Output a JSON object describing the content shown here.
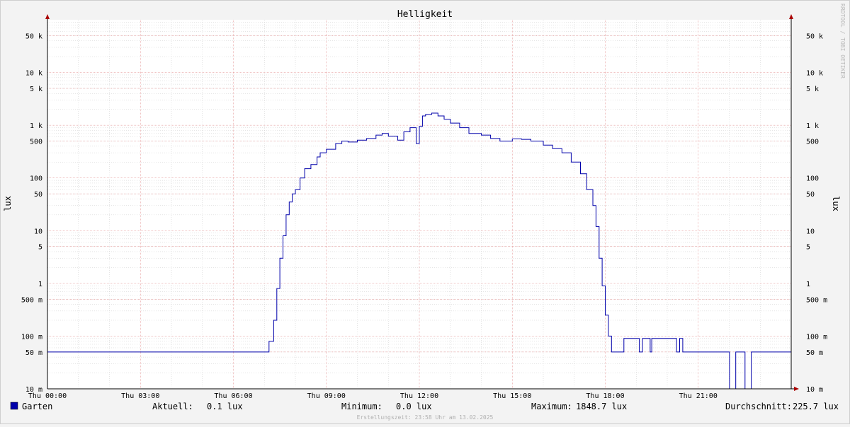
{
  "chart_data": {
    "type": "line",
    "title": "Helligkeit",
    "ylabel": "lux",
    "yscale": "log",
    "ylim": [
      0.01,
      100000
    ],
    "xlim": [
      0,
      24
    ],
    "grid": true,
    "watermark": "RRDTOOL / TOBI OETIKER",
    "y_ticks": [
      {
        "v": 50000,
        "label": "50 k"
      },
      {
        "v": 10000,
        "label": "10 k"
      },
      {
        "v": 5000,
        "label": "5 k"
      },
      {
        "v": 1000,
        "label": "1 k"
      },
      {
        "v": 500,
        "label": "500"
      },
      {
        "v": 100,
        "label": "100"
      },
      {
        "v": 50,
        "label": "50"
      },
      {
        "v": 10,
        "label": "10"
      },
      {
        "v": 5,
        "label": "5"
      },
      {
        "v": 1,
        "label": "1"
      },
      {
        "v": 0.5,
        "label": "500 m"
      },
      {
        "v": 0.1,
        "label": "100 m"
      },
      {
        "v": 0.05,
        "label": "50 m"
      },
      {
        "v": 0.01,
        "label": "10 m"
      }
    ],
    "x_ticks": [
      {
        "v": 0,
        "label": "Thu 00:00"
      },
      {
        "v": 3,
        "label": "Thu 03:00"
      },
      {
        "v": 6,
        "label": "Thu 06:00"
      },
      {
        "v": 9,
        "label": "Thu 09:00"
      },
      {
        "v": 12,
        "label": "Thu 12:00"
      },
      {
        "v": 15,
        "label": "Thu 15:00"
      },
      {
        "v": 18,
        "label": "Thu 18:00"
      },
      {
        "v": 21,
        "label": "Thu 21:00"
      }
    ],
    "series": [
      {
        "name": "Garten",
        "color": "#0000aa",
        "x": [
          0,
          7.1,
          7.15,
          7.3,
          7.4,
          7.5,
          7.6,
          7.7,
          7.8,
          7.9,
          8.0,
          8.15,
          8.3,
          8.5,
          8.7,
          8.8,
          9.0,
          9.3,
          9.5,
          9.7,
          10.0,
          10.3,
          10.6,
          10.8,
          11.0,
          11.3,
          11.5,
          11.7,
          11.9,
          12.0,
          12.1,
          12.2,
          12.4,
          12.6,
          12.8,
          13.0,
          13.3,
          13.6,
          14.0,
          14.3,
          14.6,
          15.0,
          15.3,
          15.6,
          16.0,
          16.3,
          16.6,
          16.9,
          17.2,
          17.4,
          17.6,
          17.7,
          17.8,
          17.9,
          18.0,
          18.1,
          18.2,
          18.4,
          18.6,
          19.0,
          19.1,
          19.2,
          19.4,
          19.45,
          19.5,
          20.2,
          20.3,
          20.4,
          20.5,
          22.0,
          22.01,
          22.2,
          22.21,
          22.5,
          22.51,
          22.7,
          22.71,
          24.0
        ],
        "values": [
          0.05,
          0.05,
          0.08,
          0.2,
          0.8,
          3,
          8,
          20,
          35,
          50,
          60,
          100,
          150,
          180,
          250,
          300,
          350,
          450,
          500,
          480,
          520,
          560,
          650,
          700,
          620,
          520,
          750,
          900,
          450,
          950,
          1500,
          1600,
          1700,
          1500,
          1300,
          1100,
          900,
          700,
          650,
          560,
          500,
          550,
          540,
          500,
          420,
          360,
          300,
          200,
          120,
          60,
          30,
          12,
          3,
          0.9,
          0.25,
          0.1,
          0.05,
          0.05,
          0.09,
          0.09,
          0.05,
          0.09,
          0.09,
          0.05,
          0.09,
          0.09,
          0.05,
          0.09,
          0.05,
          0.05,
          0.01,
          0.01,
          0.05,
          0.05,
          0.01,
          0.01,
          0.05,
          0.05
        ]
      }
    ]
  },
  "legend": {
    "series_name": "Garten",
    "aktuell_label": "Aktuell:",
    "aktuell_value": "0.1 lux",
    "minimum_label": "Minimum:",
    "minimum_value": "0.0 lux",
    "maximum_label": "Maximum:",
    "maximum_value": "1848.7 lux",
    "durchschnitt_label": "Durchschnitt:",
    "durchschnitt_value": "225.7 lux"
  },
  "footer": {
    "timestamp": "Erstellungszeit: 23:58 Uhr am 13.02.2025"
  },
  "colors": {
    "series": "#0000aa",
    "grid_major": "#e08a8a",
    "grid_minor": "#cccccc",
    "background": "#f3f3f3",
    "plot_background": "#ffffff",
    "axis_arrow": "#aa0000"
  }
}
